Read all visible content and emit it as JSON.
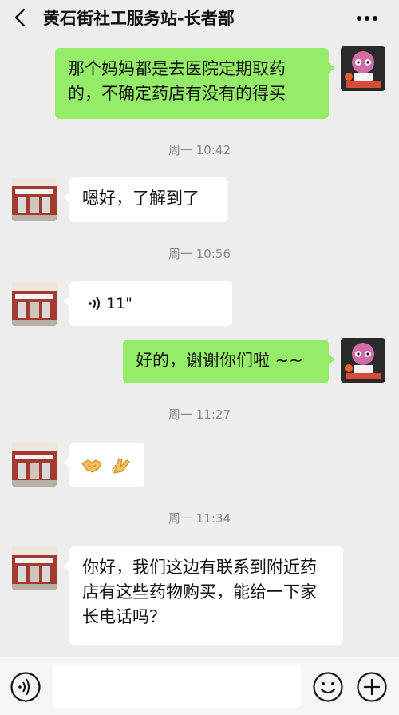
{
  "header": {
    "title": "黄石街社工服务站-长者部"
  },
  "messages": [
    {
      "type": "text",
      "from": "me",
      "text": "那个妈妈都是去医院定期取药的，不确定药店有没有的得买"
    },
    {
      "type": "time",
      "text": "周一 10:42"
    },
    {
      "type": "text",
      "from": "other",
      "text": "嗯好，了解到了"
    },
    {
      "type": "time",
      "text": "周一 10:56"
    },
    {
      "type": "voice",
      "from": "other",
      "duration": "11\""
    },
    {
      "type": "text",
      "from": "me",
      "text": "好的，谢谢你们啦 ~~"
    },
    {
      "type": "time",
      "text": "周一 11:27"
    },
    {
      "type": "emoji",
      "from": "other",
      "emojis": [
        "handshake",
        "clapping-hands"
      ]
    },
    {
      "type": "time",
      "text": "周一 11:34"
    },
    {
      "type": "text",
      "from": "other",
      "text": "你好，我们这边有联系到附近药店有这些药物购买，能给一下家长电话吗？"
    }
  ],
  "colors": {
    "background": "#ededed",
    "my_bubble": "#95ec69",
    "other_bubble": "#ffffff",
    "timestamp": "#8a8a8a"
  },
  "icons": [
    "back-arrow-icon",
    "more-dots-icon",
    "voice-icon",
    "emoji-icon",
    "plus-icon"
  ]
}
